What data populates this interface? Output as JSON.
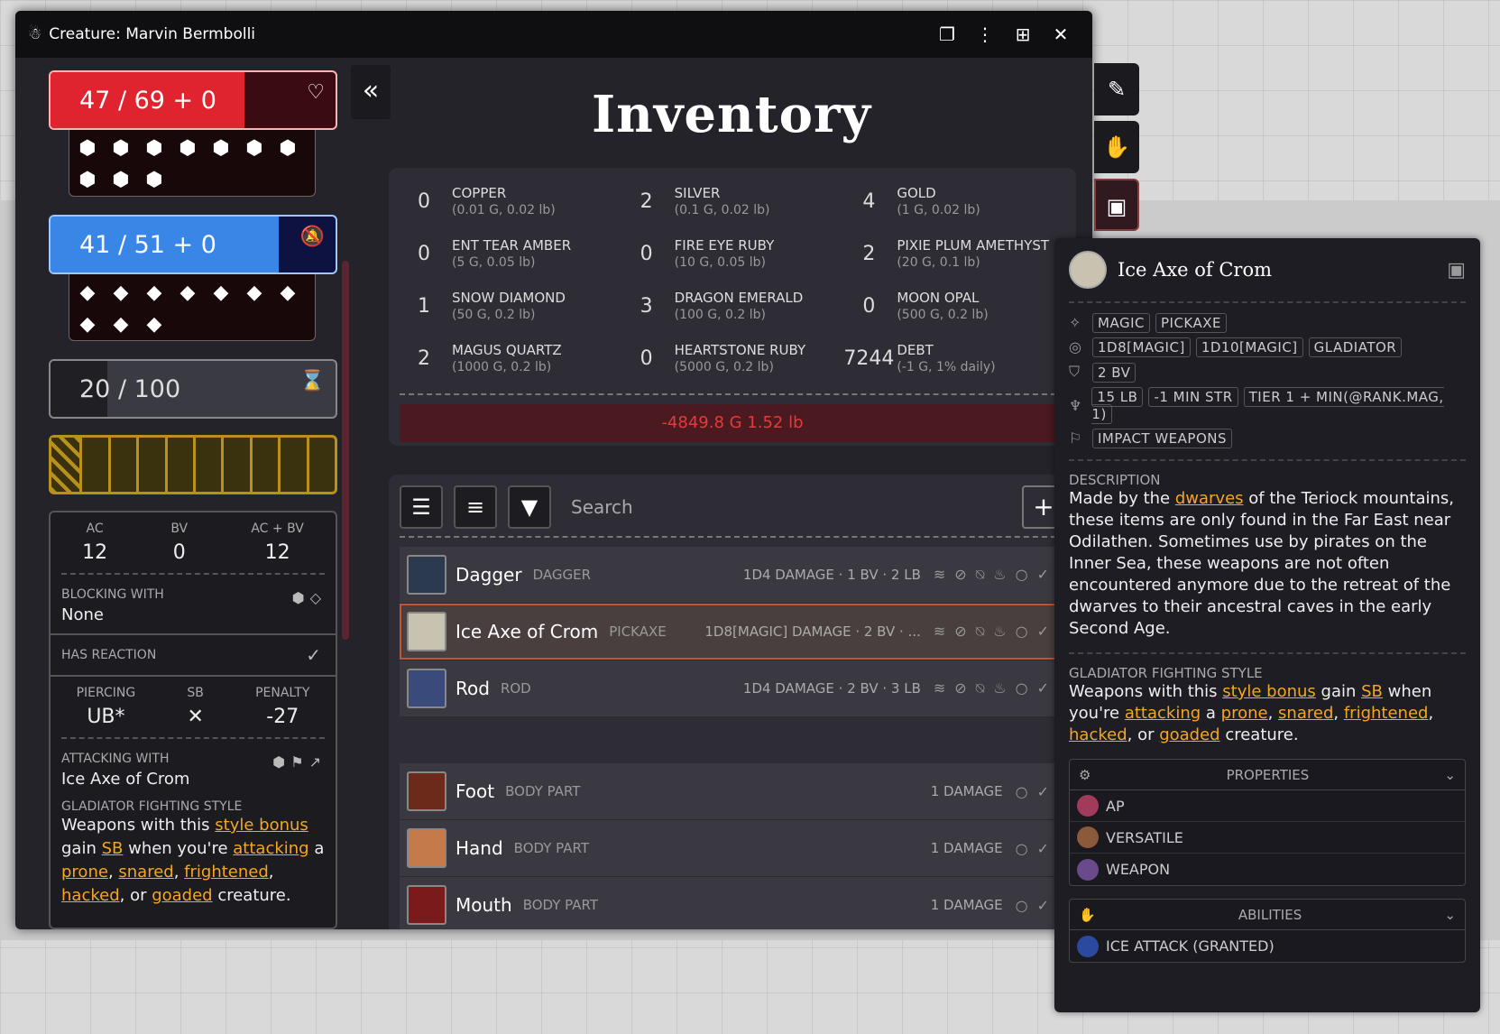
{
  "window": {
    "title": "Creature: Marvin Bermbolli"
  },
  "left": {
    "hp": {
      "text": "47 / 69 + 0",
      "icon": "♡",
      "fill": 0.68
    },
    "mp": {
      "text": "41 / 51 + 0",
      "icon": "🔕",
      "fill": 0.8
    },
    "xp": {
      "text": "20 / 100",
      "icon": "⌛",
      "fill": 0.2
    },
    "ac": {
      "label": "AC",
      "value": "12"
    },
    "bv": {
      "label": "BV",
      "value": "0"
    },
    "acbv": {
      "label": "AC + BV",
      "value": "12"
    },
    "blocking": {
      "label": "BLOCKING WITH",
      "value": "None"
    },
    "reaction": {
      "label": "HAS REACTION",
      "icon": "✓"
    },
    "piercing": {
      "label": "PIERCING",
      "value": "UB*"
    },
    "sb": {
      "label": "SB",
      "value": "✕"
    },
    "penalty": {
      "label": "PENALTY",
      "value": "-27"
    },
    "attacking": {
      "label": "ATTACKING WITH",
      "value": "Ice Axe of Crom"
    },
    "style": {
      "label": "GLADIATOR FIGHTING STYLE",
      "t1": "Weapons with this ",
      "l1": "style bonus",
      "t2": " gain ",
      "l2": "SB",
      "t3": " when you're ",
      "l3": "attacking",
      "t4": " a ",
      "l4": "prone",
      "t5": ", ",
      "l5": "snared",
      "t6": ", ",
      "l6": "frightened",
      "t7": ", ",
      "l7": "hacked",
      "t8": ", or ",
      "l8": "goaded",
      "t9": " creature."
    }
  },
  "inventory": {
    "title": "Inventory",
    "currency": [
      {
        "amount": "0",
        "name": "COPPER",
        "sub": "(0.01 G, 0.02 lb)"
      },
      {
        "amount": "2",
        "name": "SILVER",
        "sub": "(0.1 G, 0.02 lb)"
      },
      {
        "amount": "4",
        "name": "GOLD",
        "sub": "(1 G, 0.02 lb)"
      },
      {
        "amount": "0",
        "name": "ENT TEAR AMBER",
        "sub": "(5 G, 0.05 lb)"
      },
      {
        "amount": "0",
        "name": "FIRE EYE RUBY",
        "sub": "(10 G, 0.05 lb)"
      },
      {
        "amount": "2",
        "name": "PIXIE PLUM AMETHYST",
        "sub": "(20 G, 0.1 lb)"
      },
      {
        "amount": "1",
        "name": "SNOW DIAMOND",
        "sub": "(50 G, 0.2 lb)"
      },
      {
        "amount": "3",
        "name": "DRAGON EMERALD",
        "sub": "(100 G, 0.2 lb)"
      },
      {
        "amount": "0",
        "name": "MOON OPAL",
        "sub": "(500 G, 0.2 lb)"
      },
      {
        "amount": "2",
        "name": "MAGUS QUARTZ",
        "sub": "(1000 G, 0.2 lb)"
      },
      {
        "amount": "0",
        "name": "HEARTSTONE RUBY",
        "sub": "(5000 G, 0.2 lb)"
      },
      {
        "amount": "7244",
        "name": "DEBT",
        "sub": "(-1 G, 1% daily)"
      }
    ],
    "totals": "-4849.8 G   1.52 lb",
    "search_placeholder": "Search",
    "weapons": [
      {
        "name": "Dagger",
        "type": "DAGGER",
        "dmg": "1D4 DAMAGE · 1 BV · 2 LB"
      },
      {
        "name": "Ice Axe of Crom",
        "type": "PICKAXE",
        "dmg": "1D8[MAGIC] DAMAGE · 2 BV · ..."
      },
      {
        "name": "Rod",
        "type": "ROD",
        "dmg": "1D4 DAMAGE · 2 BV · 3 LB"
      }
    ],
    "body": [
      {
        "name": "Foot",
        "type": "BODY PART",
        "dmg": "1 DAMAGE"
      },
      {
        "name": "Hand",
        "type": "BODY PART",
        "dmg": "1 DAMAGE"
      },
      {
        "name": "Mouth",
        "type": "BODY PART",
        "dmg": "1 DAMAGE"
      }
    ]
  },
  "detail": {
    "title": "Ice Axe of Crom",
    "tags1": [
      "MAGIC",
      "PICKAXE"
    ],
    "tags2": [
      "1D8[MAGIC]",
      "1D10[MAGIC]",
      "GLADIATOR"
    ],
    "tags3": [
      "2 BV"
    ],
    "tags4": [
      "15 LB",
      "-1 MIN STR",
      "TIER 1 + MIN(@RANK.MAG, 1)"
    ],
    "tags5": [
      "IMPACT WEAPONS"
    ],
    "desc_label": "DESCRIPTION",
    "desc": {
      "t1": "Made by the ",
      "l1": "dwarves",
      "t2": " of the Teriock mountains, these items are only found in the Far East near Odilathen. Sometimes use by pirates on the Inner Sea, these weapons are not often encountered anymore due to the retreat of the dwarves to their ancestral caves in the early Second Age."
    },
    "style_label": "GLADIATOR FIGHTING STYLE",
    "style": {
      "t1": "Weapons with this ",
      "l1": "style bonus",
      "t2": " gain ",
      "l2": "SB",
      "t3": " when you're ",
      "l3": "attacking",
      "t4": " a ",
      "l4": "prone",
      "t5": ", ",
      "l5": "snared",
      "t6": ", ",
      "l6": "frightened",
      "t7": ", ",
      "l7": "hacked",
      "t8": ", or ",
      "l8": "goaded",
      "t9": " creature."
    },
    "properties_label": "PROPERTIES",
    "properties": [
      "AP",
      "VERSATILE",
      "WEAPON"
    ],
    "abilities_label": "ABILITIES",
    "abilities": [
      "ICE ATTACK (GRANTED)"
    ]
  }
}
